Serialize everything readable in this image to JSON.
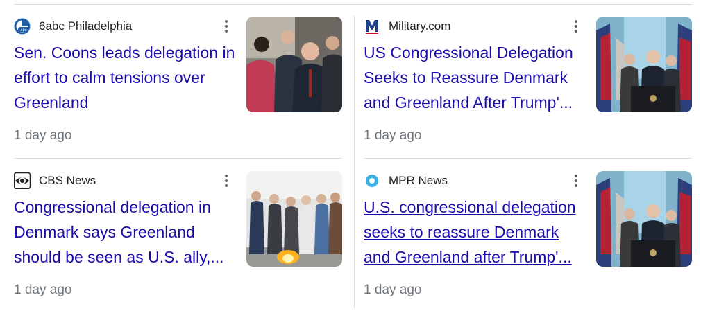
{
  "articles": [
    {
      "source": "6abc Philadelphia",
      "source_icon": "6abc-logo-icon",
      "headline": "Sen. Coons leads delegation in effort to calm tensions over Greenland",
      "time": "1 day ago",
      "thumbnail": "delegation-meeting-photo"
    },
    {
      "source": "Military.com",
      "source_icon": "military-com-logo-icon",
      "headline": "US Congressional Delegation Seeks to Reassure Denmark and Greenland After Trump'...",
      "time": "1 day ago",
      "thumbnail": "press-conference-flags-photo"
    },
    {
      "source": "CBS News",
      "source_icon": "cbs-eye-logo-icon",
      "headline": "Congressional delegation in Denmark says Greenland should be seen as U.S. ally,...",
      "time": "1 day ago",
      "thumbnail": "memorial-flame-photo"
    },
    {
      "source": "MPR News",
      "source_icon": "mpr-logo-icon",
      "headline": "U.S. congressional delegation seeks to reassure Denmark and Greenland after Trump'...",
      "time": "1 day ago",
      "thumbnail": "press-conference-flags-photo"
    }
  ],
  "colors": {
    "headline": "#1a0dab",
    "meta": "#70757a",
    "divider": "#dadce0"
  }
}
